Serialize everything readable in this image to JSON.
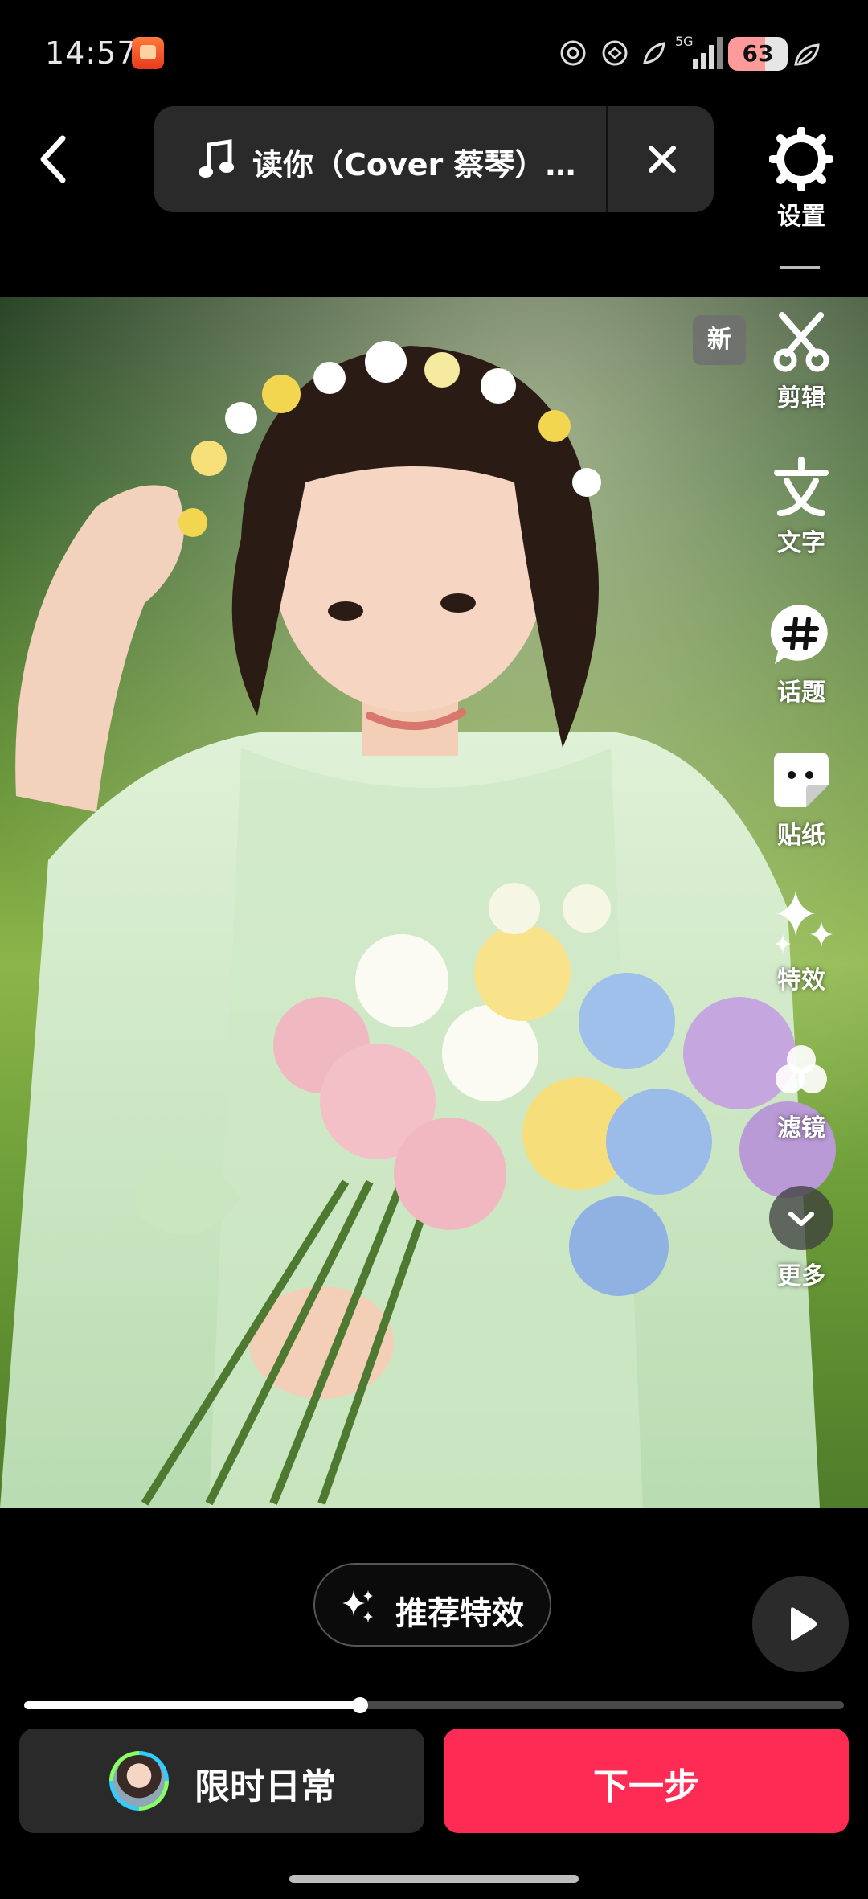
{
  "status_bar": {
    "time": "14:57",
    "network": "5G",
    "battery": "63"
  },
  "music": {
    "title": "读你（Cover 蔡琴）…"
  },
  "toolbar": {
    "settings": "设置",
    "edit": "剪辑",
    "text": "文字",
    "topic": "话题",
    "sticker": "贴纸",
    "effects": "特效",
    "filter": "滤镜",
    "more": "更多",
    "new_badge": "新"
  },
  "bottom": {
    "recommend_effects": "推荐特效",
    "progress_value": 0.41,
    "daily_label": "限时日常",
    "next_label": "下一步"
  },
  "colors": {
    "primary": "#fe2c55",
    "panel": "#2a2a2a"
  }
}
